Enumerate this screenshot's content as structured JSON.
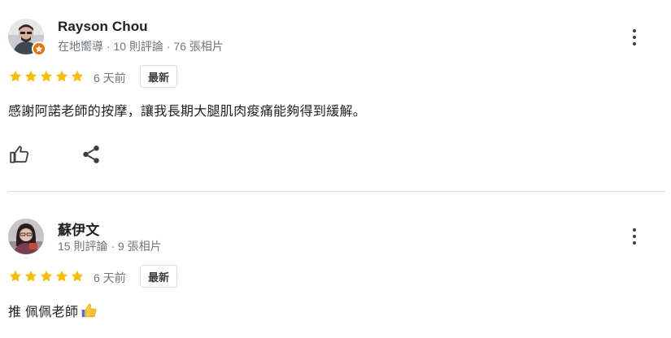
{
  "reviews": [
    {
      "reviewer_name": "Rayson Chou",
      "reviewer_meta": "在地嚮導 · 10 則評論 · 76 張相片",
      "rating": 5,
      "time_ago": "6 天前",
      "badge": "最新",
      "text": "感謝阿諾老師的按摩，讓我長期大腿肌肉痠痛能夠得到緩解。",
      "local_guide": true,
      "avatar_color": "#4a5560"
    },
    {
      "reviewer_name": "蘇伊文",
      "reviewer_meta": "15 則評論 · 9 張相片",
      "rating": 5,
      "time_ago": "6 天前",
      "badge": "最新",
      "text": "推 佩佩老師",
      "text_emoji": "thumbs-up-emoji",
      "local_guide": false,
      "avatar_color": "#7a3e52"
    }
  ],
  "colors": {
    "star": "#fbbc04",
    "local_guide_badge": "#e8710a",
    "meta_text": "#70757a",
    "divider": "#e0e0e0"
  },
  "icons": {
    "like": "thumbs-up-icon",
    "share": "share-icon",
    "more": "more-vertical-icon",
    "star": "star-icon"
  }
}
